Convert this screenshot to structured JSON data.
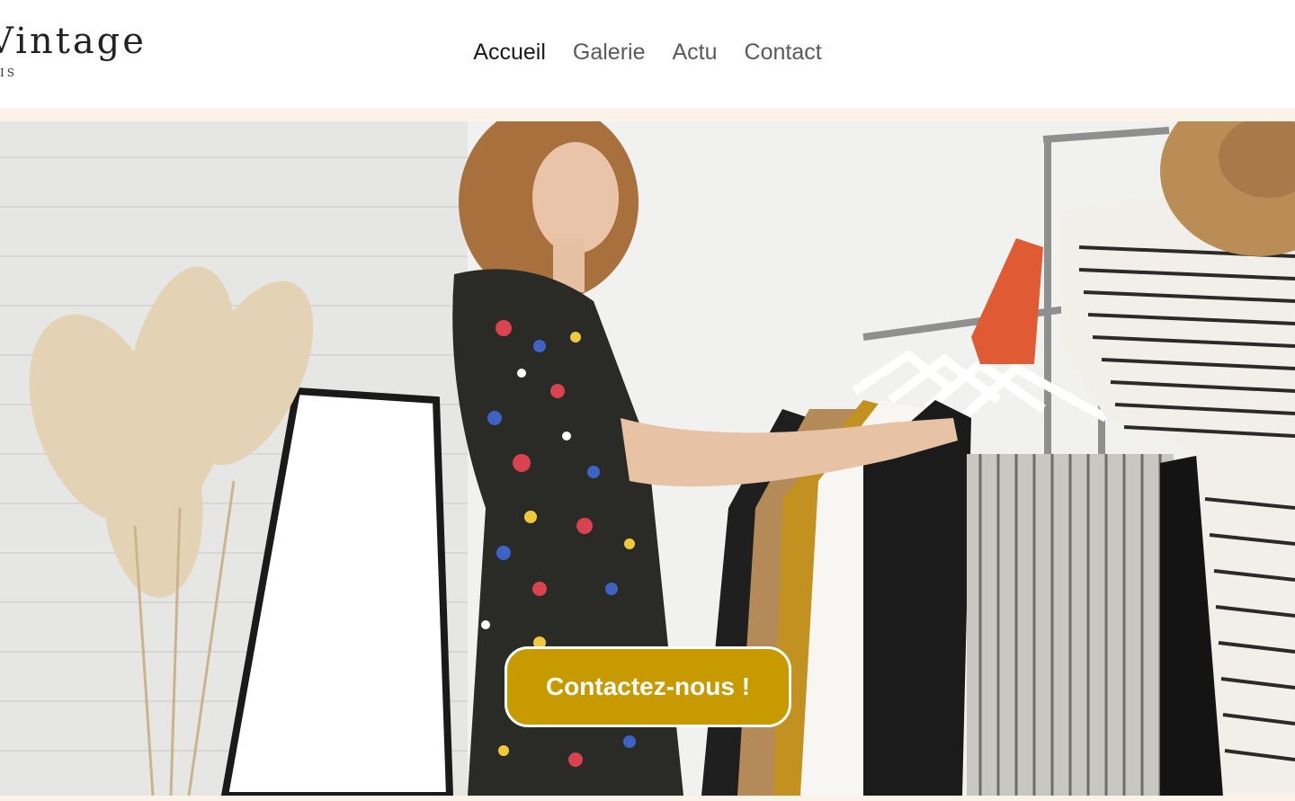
{
  "brand": {
    "name": "Vintage",
    "subtitle": "IS"
  },
  "nav": {
    "items": [
      {
        "label": "Accueil",
        "active": true
      },
      {
        "label": "Galerie",
        "active": false
      },
      {
        "label": "Actu",
        "active": false
      },
      {
        "label": "Contact",
        "active": false
      }
    ]
  },
  "hero": {
    "cta_label": "Contactez-nous !",
    "image_description_icon": "hero-photo"
  },
  "colors": {
    "accent": "#c79a00",
    "strip": "#fbf2e8",
    "nav_text": "#5a5a5a",
    "nav_active": "#1a1a1a"
  }
}
